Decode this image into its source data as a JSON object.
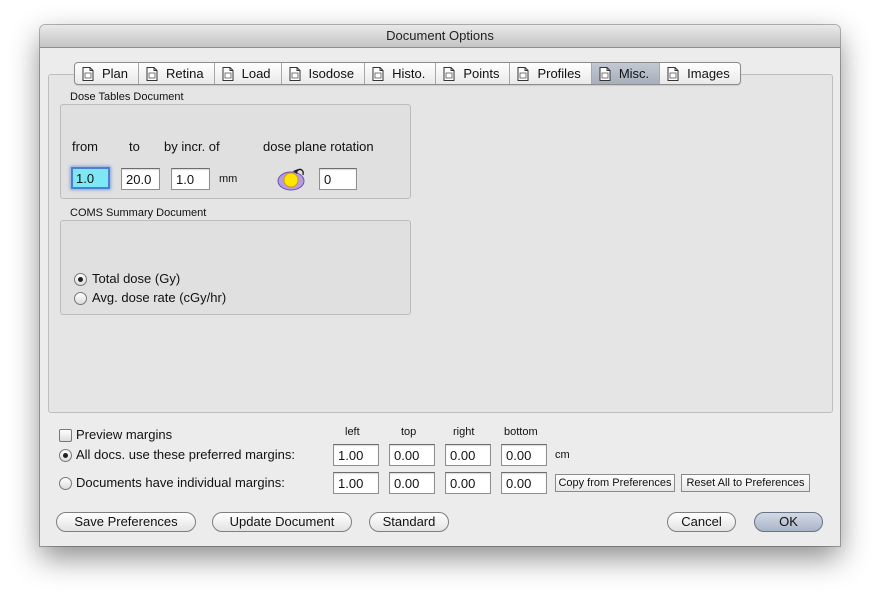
{
  "window": {
    "title": "Document Options"
  },
  "tabs": [
    {
      "label": "Plan"
    },
    {
      "label": "Retina"
    },
    {
      "label": "Load"
    },
    {
      "label": "Isodose"
    },
    {
      "label": "Histo."
    },
    {
      "label": "Points"
    },
    {
      "label": "Profiles"
    },
    {
      "label": "Misc.",
      "selected": true
    },
    {
      "label": "Images"
    }
  ],
  "dose_tables": {
    "title": "Dose Tables Document",
    "from_label": "from",
    "to_label": "to",
    "incr_label": "by incr. of",
    "rotation_label": "dose plane rotation",
    "from_value": "1.0",
    "to_value": "20.0",
    "incr_value": "1.0",
    "unit": "mm",
    "rotation_value": "0"
  },
  "coms": {
    "title": "COMS Summary Document",
    "option_total": "Total dose (Gy)",
    "option_rate": "Avg. dose rate (cGy/hr)",
    "selected": "Total dose (Gy)"
  },
  "margins": {
    "preview_label": "Preview margins",
    "preview_checked": false,
    "col_left": "left",
    "col_top": "top",
    "col_right": "right",
    "col_bottom": "bottom",
    "all_label": "All docs. use these preferred margins:",
    "individual_label": "Documents have individual margins:",
    "selected": "All docs. use these preferred margins:",
    "unit": "cm",
    "preferred": {
      "left": "1.00",
      "top": "0.00",
      "right": "0.00",
      "bottom": "0.00"
    },
    "individual": {
      "left": "1.00",
      "top": "0.00",
      "right": "0.00",
      "bottom": "0.00"
    },
    "copy_button": "Copy from Preferences",
    "reset_button": "Reset All to Preferences"
  },
  "buttons": {
    "save": "Save Preferences",
    "update": "Update Document",
    "standard": "Standard",
    "cancel": "Cancel",
    "ok": "OK"
  },
  "icons": {
    "tab_icon": "document-icon",
    "rotation_icon": "rotate-icon"
  }
}
